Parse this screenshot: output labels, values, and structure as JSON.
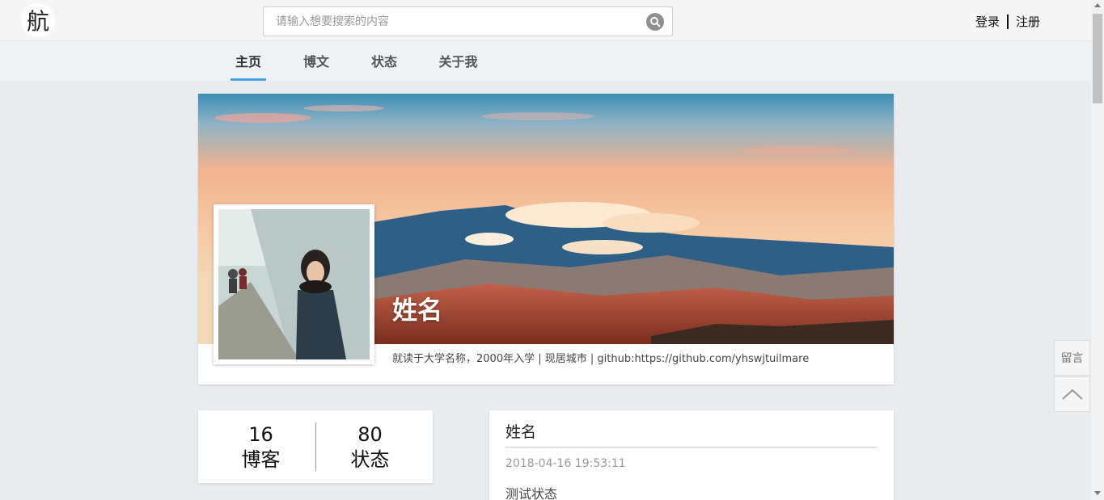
{
  "header": {
    "logo_text": "航",
    "search": {
      "placeholder": "请输入想要搜索的内容",
      "value": ""
    },
    "login_label": "登录",
    "register_label": "注册"
  },
  "nav": {
    "tabs": [
      {
        "label": "主页",
        "active": true
      },
      {
        "label": "博文",
        "active": false
      },
      {
        "label": "状态",
        "active": false
      },
      {
        "label": "关于我",
        "active": false
      }
    ]
  },
  "profile": {
    "name": "姓名",
    "bio": "就读于大学名称，2000年入学 | 现居城市 | github:https://github.com/yhswjtuilmare"
  },
  "stats": [
    {
      "value": "16",
      "label": "博客"
    },
    {
      "value": "80",
      "label": "状态"
    }
  ],
  "status_post": {
    "author": "姓名",
    "time": "2018-04-16 19:53:11",
    "text": "测试状态"
  },
  "floating": {
    "message_label": "留言"
  },
  "colors": {
    "accent": "#4aa3df",
    "page_bg": "#e9ecef",
    "nav_bg": "#eef2f5"
  }
}
